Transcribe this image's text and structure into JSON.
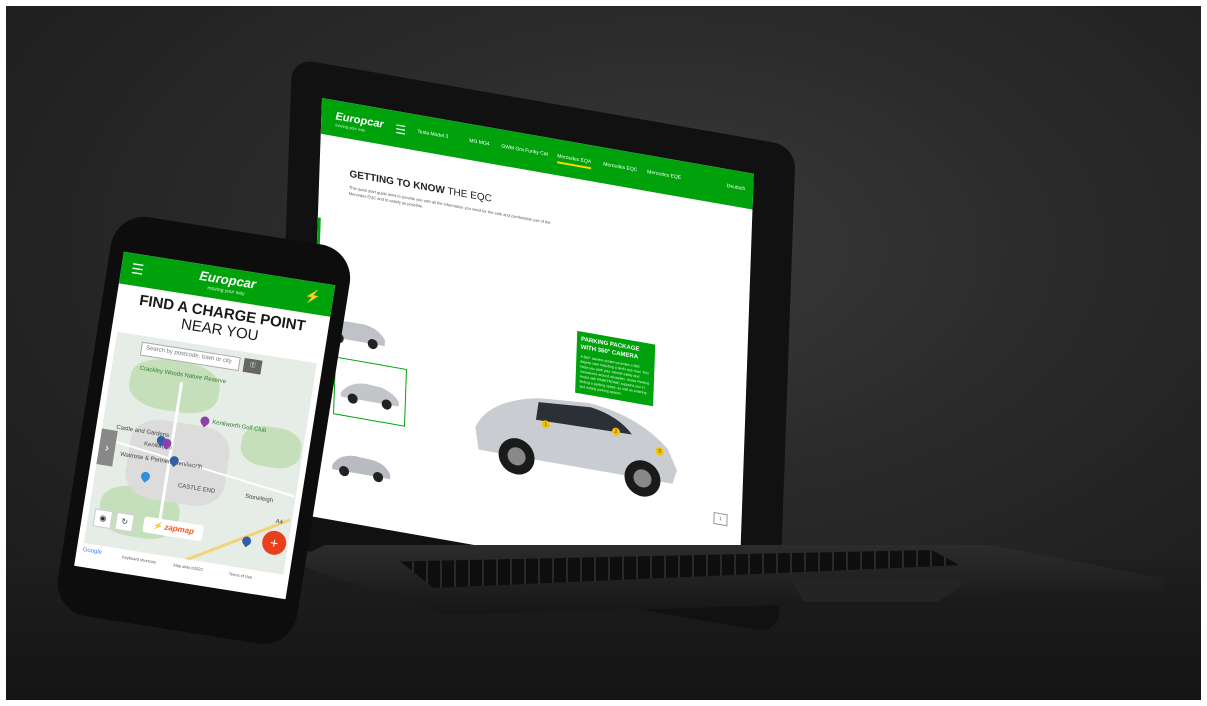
{
  "laptop": {
    "brand": "Europcar",
    "brand_tagline": "moving your way",
    "menu_icon": "hamburger-icon",
    "tabs": [
      "Tesla Model 3",
      "MG MG4",
      "GWM Ora Funky Cat",
      "Mercedes EQA",
      "Mercedes EQC",
      "Mercedes EQE"
    ],
    "active_tab": 3,
    "language": "Deutsch",
    "heading_bold": "GETTING TO KNOW",
    "heading_light": "THE EQC",
    "description": "This quick start guide aims to provide you with all the information you need for the safe and comfortable use of the Mercedes EQC and to satisfy as possible.",
    "callout": {
      "title": "PARKING PACKAGE WITH 360° CAMERA",
      "body": "A 360° camera system provides a 360-degree view including a bird's eye view. This helps you park your vehicle safely and manoeuvre around obstacles. Active Parking Assist with PARKTRONIC supports you in finding a parking space, as well as entering and exiting parking spaces."
    },
    "hotspots": [
      "1",
      "2",
      "3"
    ],
    "page_indicator": "1",
    "accent_color": "#00a20c",
    "hotspot_color": "#f2c500"
  },
  "phone": {
    "brand": "Europcar",
    "brand_tagline": "moving your way",
    "menu_icon": "hamburger-icon",
    "charge_icon": "lightning-icon",
    "title_line1": "FIND A CHARGE POINT",
    "title_line2": "NEAR YOU",
    "search_placeholder": "Search by postcode, town or city",
    "map_labels": {
      "woods": "Crackley Woods Nature Reserve",
      "golf": "Kenilworth Golf Club",
      "castle": "Castle and Gardens",
      "town": "Kenilworth",
      "waitrose": "Waitrose & Partners Kenilworth",
      "district": "CASTLE END",
      "stoneleigh": "Stoneleigh",
      "road": "A4"
    },
    "zapmap_label": "zapmap",
    "fab_label": "+",
    "footer_google": "Google",
    "footer_shortcuts": "Keyboard shortcuts",
    "footer_mapdata": "Map data ©2023",
    "footer_terms": "Terms of Use",
    "accent_color": "#00a20c",
    "fab_color": "#e8401c",
    "zapmap_color": "#f15a24"
  }
}
